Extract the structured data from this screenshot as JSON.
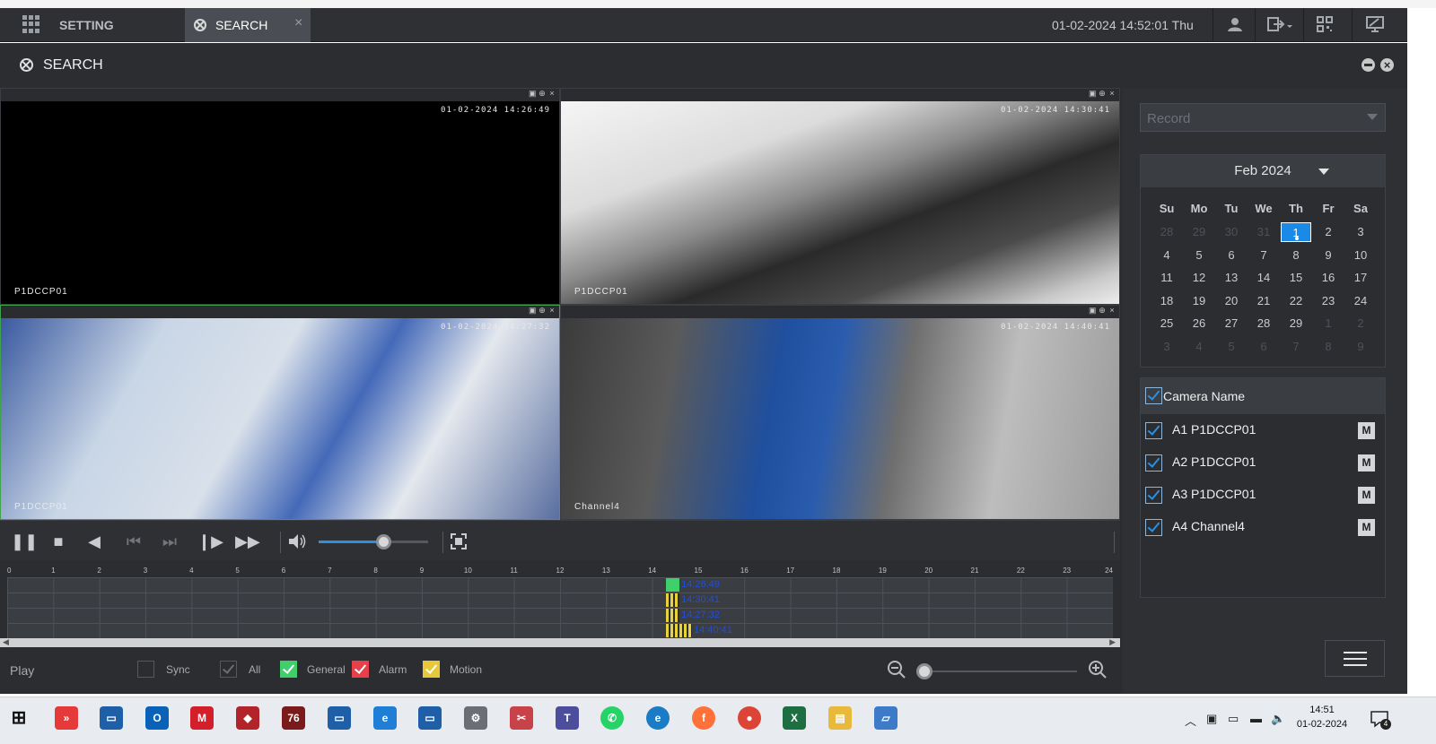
{
  "topbar": {
    "setting_label": "SETTING",
    "search_tab_label": "SEARCH",
    "tab_close": "×",
    "datetime": "01-02-2024 14:52:01 Thu"
  },
  "header": {
    "title": "SEARCH"
  },
  "panes": [
    {
      "timestamp": "01-02-2024 14:26:49",
      "name": "P1DCCP01"
    },
    {
      "timestamp": "01-02-2024 14:30:41",
      "name": "P1DCCP01"
    },
    {
      "timestamp": "01-02-2024 14:27:32",
      "name": "P1DCCP01"
    },
    {
      "timestamp": "01-02-2024 14:40:41",
      "name": "Channel4"
    }
  ],
  "controls": {
    "volume_level": 0.6
  },
  "timeline": {
    "hours": [
      "0",
      "1",
      "2",
      "3",
      "4",
      "5",
      "6",
      "7",
      "8",
      "9",
      "10",
      "11",
      "12",
      "13",
      "14",
      "15",
      "16",
      "17",
      "18",
      "19",
      "20",
      "21",
      "22",
      "23",
      "24"
    ],
    "tracks": [
      {
        "label": "14:26:49",
        "type": "general"
      },
      {
        "label": "14:30:41",
        "type": "motion"
      },
      {
        "label": "14:27:32",
        "type": "motion"
      },
      {
        "label": "14:40:41",
        "type": "motion"
      }
    ]
  },
  "bottombar": {
    "play_label": "Play",
    "sync_label": "Sync",
    "all_label": "All",
    "general_label": "General",
    "alarm_label": "Alarm",
    "motion_label": "Motion",
    "zoom_level": 0
  },
  "sidebar": {
    "record_select": "Record",
    "calendar": {
      "month": "Feb 2024",
      "dow": [
        "Su",
        "Mo",
        "Tu",
        "We",
        "Th",
        "Fr",
        "Sa"
      ],
      "weeks": [
        [
          "28",
          "29",
          "30",
          "31",
          "1",
          "2",
          "3"
        ],
        [
          "4",
          "5",
          "6",
          "7",
          "8",
          "9",
          "10"
        ],
        [
          "11",
          "12",
          "13",
          "14",
          "15",
          "16",
          "17"
        ],
        [
          "18",
          "19",
          "20",
          "21",
          "22",
          "23",
          "24"
        ],
        [
          "25",
          "26",
          "27",
          "28",
          "29",
          "1",
          "2"
        ],
        [
          "3",
          "4",
          "5",
          "6",
          "7",
          "8",
          "9"
        ]
      ],
      "selected": "1"
    },
    "camera_header": "Camera Name",
    "cameras": [
      {
        "label": "A1 P1DCCP01",
        "m": "M"
      },
      {
        "label": "A2 P1DCCP01",
        "m": "M"
      },
      {
        "label": "A3 P1DCCP01",
        "m": "M"
      },
      {
        "label": "A4 Channel4",
        "m": "M"
      }
    ]
  },
  "taskbar": {
    "time": "14:51",
    "date": "01-02-2024",
    "notification_count": "4"
  },
  "colors": {
    "accent": "#1a8ae6",
    "general": "#3fcf6b",
    "alarm": "#e8404a",
    "motion": "#e8c83a"
  }
}
